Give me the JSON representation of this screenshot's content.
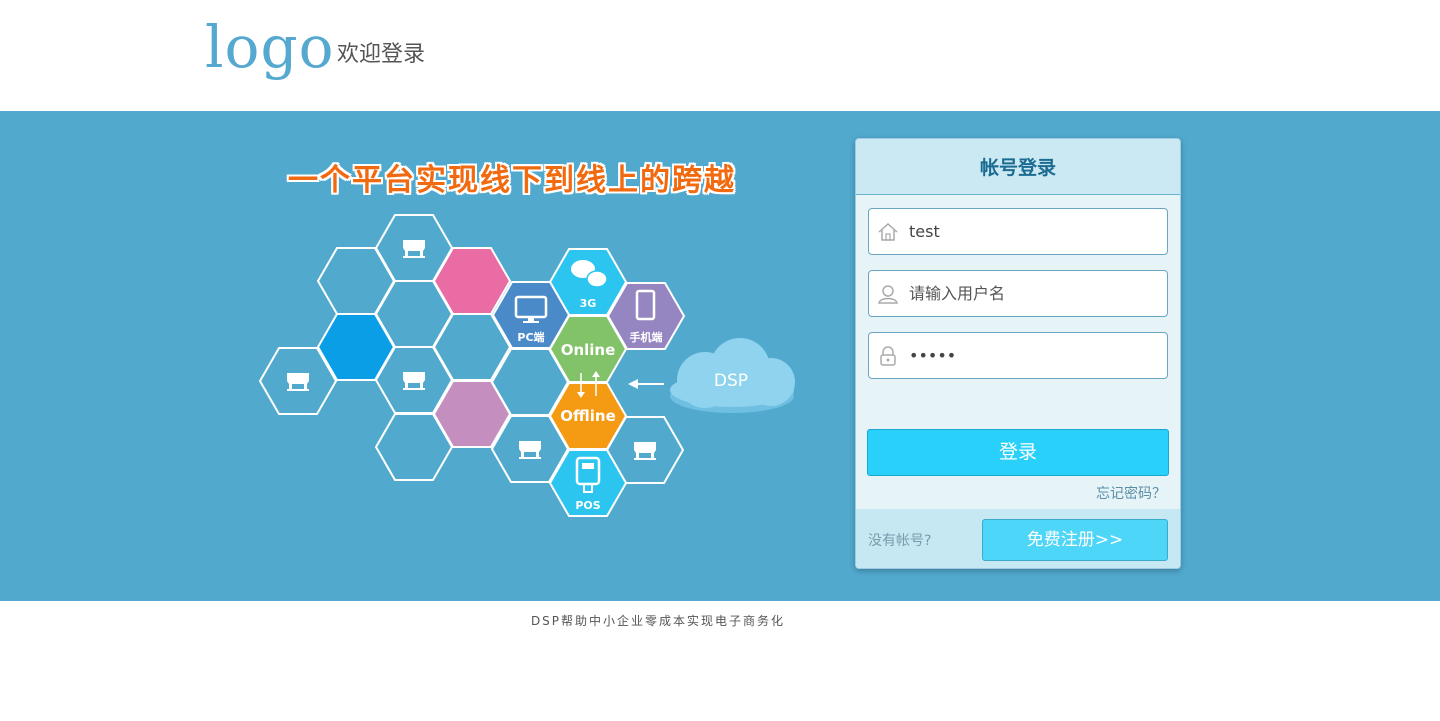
{
  "header": {
    "logo": "logo",
    "welcome": "欢迎登录"
  },
  "banner": {
    "slogan": "一个平台实现线下到线上的跨越",
    "hex_labels": {
      "wechat": "3G",
      "pc": "PC端",
      "mobile": "手机端",
      "online": "Online",
      "offline": "Offline",
      "pos": "POS",
      "cloud": "DSP"
    }
  },
  "login": {
    "title": "帐号登录",
    "account_value": "test",
    "username_placeholder": "请输入用户名",
    "password_value": "12345",
    "submit_label": "登录",
    "forgot_label": "忘记密码？",
    "no_account_label": "没有帐号?",
    "register_label": "免费注册>>"
  },
  "footer": {
    "text": "DSP帮助中小企业零成本实现电子商务化"
  },
  "colors": {
    "banner_bg": "#51a9ce",
    "logo": "#55a8cf",
    "slogan": "#f26a10",
    "login_button": "#29d0f9",
    "register_button": "#4dd6f8",
    "hex_pink": "#e96ca4",
    "hex_blue": "#0a9ee6",
    "hex_purple": "#c48fbf",
    "hex_pc": "#4a8ac9",
    "hex_wechat": "#2bc5ef",
    "hex_mobile": "#9585c1",
    "hex_online": "#82c268",
    "hex_offline": "#f59a13",
    "hex_pos": "#2bc5ef",
    "cloud": "#8fd3ef"
  }
}
